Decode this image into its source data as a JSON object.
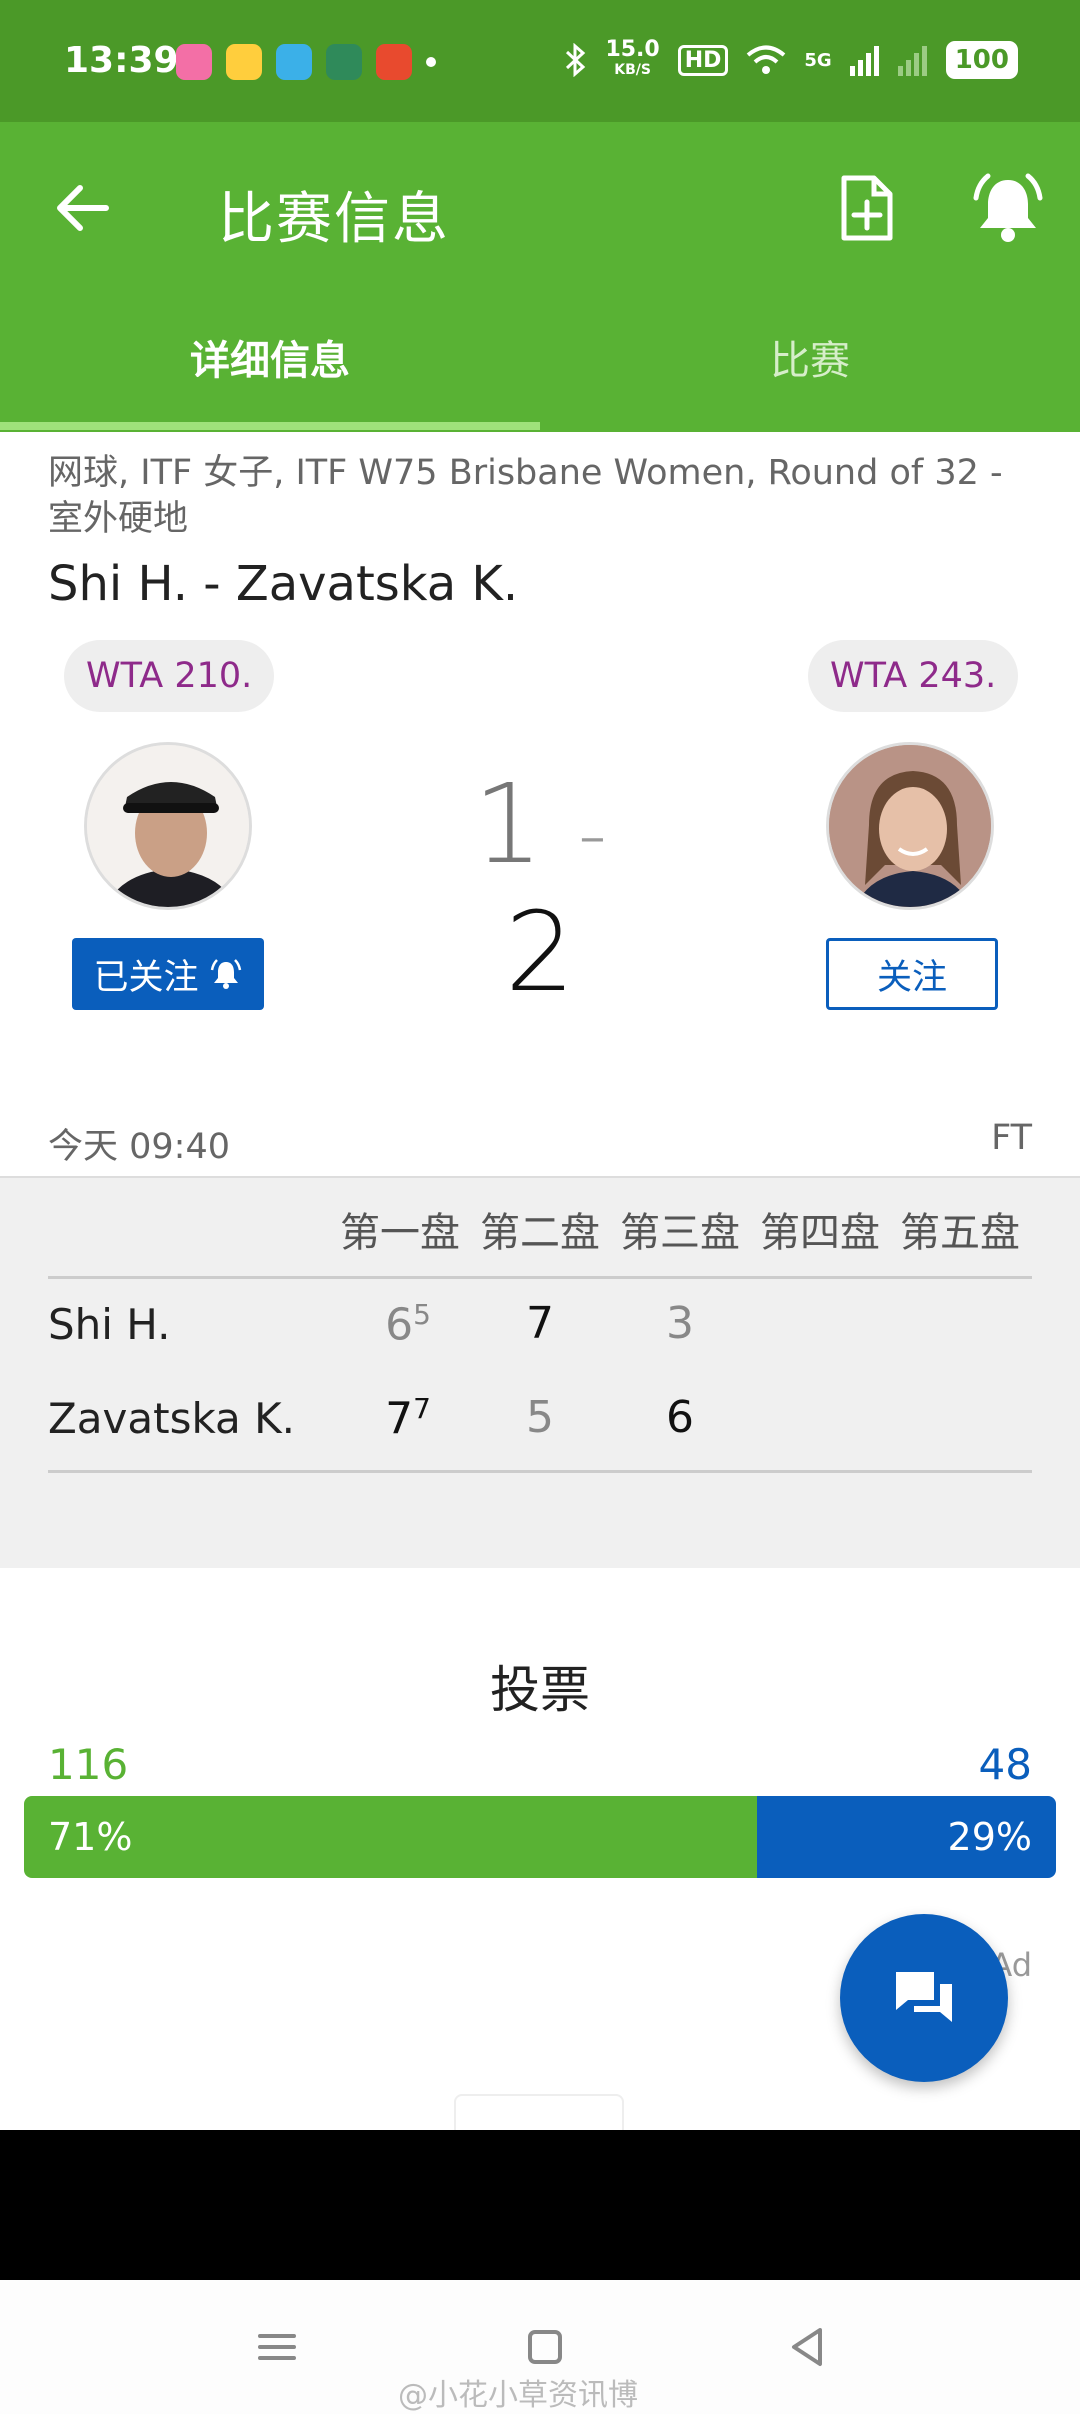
{
  "status_bar": {
    "time": "13:39",
    "net_speed": "15.0",
    "net_unit": "KB/S",
    "hd": "HD",
    "signal": "5G",
    "battery": "100"
  },
  "app_bar": {
    "title": "比赛信息",
    "tabs": [
      {
        "label": "详细信息",
        "active": true
      },
      {
        "label": "比赛",
        "active": false
      }
    ]
  },
  "match": {
    "league": "网球, ITF 女子, ITF W75 Brisbane Women, Round of 32 - 室外硬地",
    "matchup": "Shi H. - Zavatska K.",
    "home_rank": "WTA 210.",
    "away_rank": "WTA 243.",
    "score_home": "1",
    "score_sep": "-",
    "score_away": "2",
    "home_follow": "已关注",
    "away_follow": "关注",
    "time": "今天 09:40",
    "status": "FT"
  },
  "sets": {
    "headers": [
      "第一盘",
      "第二盘",
      "第三盘",
      "第四盘",
      "第五盘"
    ],
    "players": [
      {
        "name": "Shi H.",
        "scores": [
          {
            "v": "6",
            "tb": "5"
          },
          {
            "v": "7",
            "tb": ""
          },
          {
            "v": "3",
            "tb": ""
          }
        ]
      },
      {
        "name": "Zavatska K.",
        "scores": [
          {
            "v": "7",
            "tb": "7"
          },
          {
            "v": "5",
            "tb": ""
          },
          {
            "v": "6",
            "tb": ""
          }
        ]
      }
    ]
  },
  "vote": {
    "title": "投票",
    "home_count": "116",
    "away_count": "48",
    "home_pct_label": "71%",
    "away_pct_label": "29%",
    "home_fraction": 0.71
  },
  "ad_label": "Ad",
  "watermark": "@小花小草资讯博",
  "colors": {
    "status_green": "#4b9928",
    "appbar_green": "#59b234",
    "brand_blue": "#0a5ebc",
    "rank_purple": "#8e2a8a"
  },
  "icons": [
    "back-arrow-icon",
    "add-file-icon",
    "bell-icon",
    "chat-icon"
  ]
}
